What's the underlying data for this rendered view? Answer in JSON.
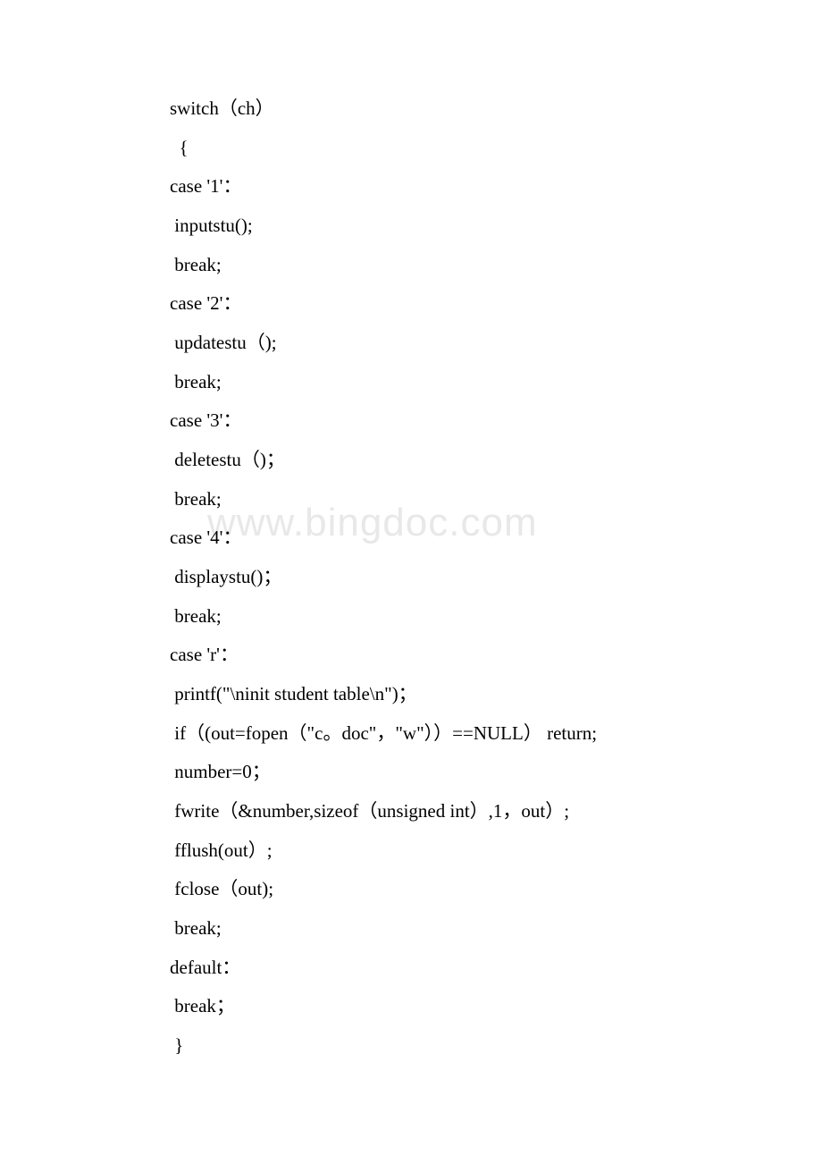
{
  "watermark": "www.bingdoc.com",
  "code_lines": [
    "switch（ch）",
    "  {",
    "case '1'：",
    " inputstu();",
    " break;",
    "case '2'：",
    " updatestu（);",
    " break;",
    "case '3'：",
    " deletestu（)；",
    " break;",
    "case '4'：",
    " displaystu()；",
    " break;",
    "case 'r'：",
    " printf(\"\\ninit student table\\n\")；",
    " if（(out=fopen（\"c。doc\"，\"w\"））==NULL） return;",
    " number=0；",
    " fwrite（&number,sizeof（unsigned int）,1，out）;",
    " fflush(out）;",
    " fclose（out);",
    " break;",
    "default：",
    " break；",
    " }"
  ]
}
